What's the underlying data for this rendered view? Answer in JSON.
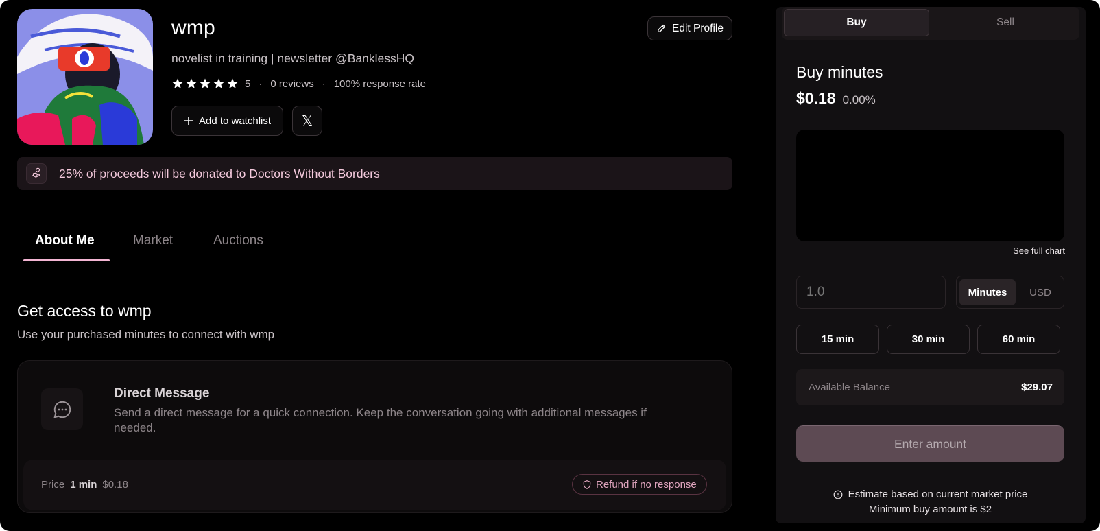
{
  "profile": {
    "name": "wmp",
    "bio": "novelist in training | newsletter @BanklessHQ",
    "rating": 5,
    "rating_label": "5",
    "reviews": "0 reviews",
    "response_rate": "100% response rate",
    "edit_label": "Edit Profile",
    "watchlist_label": "Add to watchlist",
    "x_label": "𝕏"
  },
  "donation": {
    "text": "25% of proceeds will be donated to Doctors Without Borders"
  },
  "tabs": [
    {
      "label": "About Me",
      "active": true
    },
    {
      "label": "Market",
      "active": false
    },
    {
      "label": "Auctions",
      "active": false
    }
  ],
  "access": {
    "title": "Get access to wmp",
    "subtitle": "Use your purchased minutes to connect with wmp"
  },
  "direct_message": {
    "title": "Direct Message",
    "description": "Send a direct message for a quick connection. Keep the conversation going with additional messages if needed.",
    "price_label": "Price",
    "price_min": "1 min",
    "price_value": "$0.18",
    "refund_label": "Refund if no response"
  },
  "trade": {
    "buy_tab": "Buy",
    "sell_tab": "Sell",
    "title": "Buy minutes",
    "price": "$0.18",
    "change": "0.00%",
    "see_chart": "See full chart",
    "amount_placeholder": "1.0",
    "unit_minutes": "Minutes",
    "unit_usd": "USD",
    "quick_15": "15 min",
    "quick_30": "30 min",
    "quick_60": "60 min",
    "balance_label": "Available Balance",
    "balance_value": "$29.07",
    "submit_label": "Enter amount",
    "estimate_note": "Estimate based on current market price",
    "min_note": "Minimum buy amount is $2"
  },
  "colors": {
    "accent": "#f3b5d3",
    "background": "#000000",
    "panel": "#121012"
  }
}
